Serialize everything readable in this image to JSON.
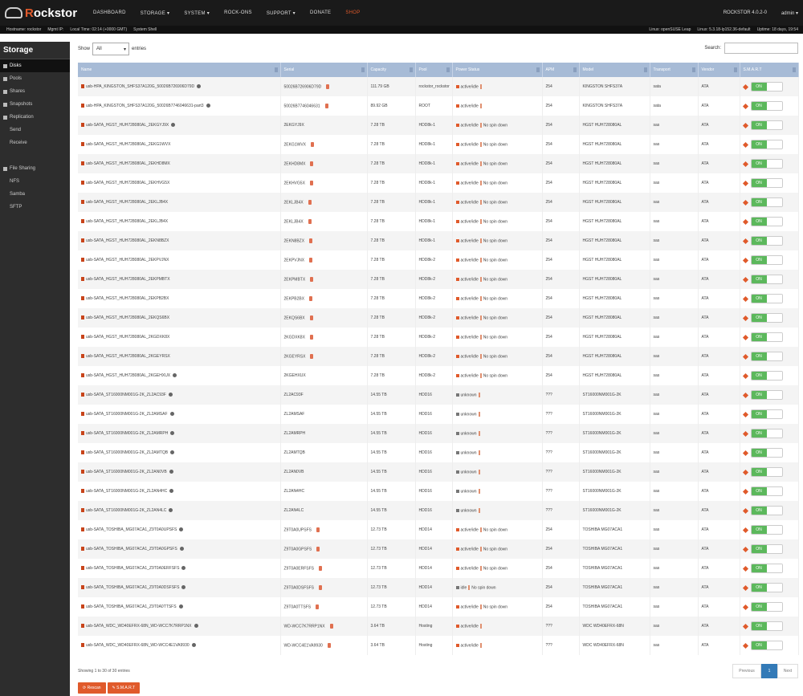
{
  "header": {
    "brand": "Rockstor",
    "nav": [
      "DASHBOARD",
      "STORAGE ▾",
      "SYSTEM ▾",
      "ROCK-ONS",
      "SUPPORT ▾",
      "DONATE",
      "SHOP"
    ],
    "version": "ROCKSTOR 4.0.2-0",
    "user": "admin ▾"
  },
  "statusbar": {
    "hostname": "Hostname: rockstor",
    "mgmt_ip": "Mgmt IP:",
    "local_time": "Local Time: 02:14 (+0000 GMT)",
    "system_shell": "System Shell",
    "os": "Linux: openSUSE Leap",
    "kernel": "Linux: 5.3.18-lp152.36-default",
    "uptime": "Uptime: 18 days, 19:54"
  },
  "sidebar": {
    "title": "Storage",
    "items": [
      {
        "label": "Disks",
        "active": true,
        "sub": false
      },
      {
        "label": "Pools",
        "active": false,
        "sub": false
      },
      {
        "label": "Shares",
        "active": false,
        "sub": false
      },
      {
        "label": "Snapshots",
        "active": false,
        "sub": false
      },
      {
        "label": "Replication",
        "active": false,
        "sub": false
      },
      {
        "label": "Send",
        "active": false,
        "sub": true
      },
      {
        "label": "Receive",
        "active": false,
        "sub": true
      },
      {
        "label": "",
        "active": false,
        "sub": false
      },
      {
        "label": "File Sharing",
        "active": false,
        "sub": false
      },
      {
        "label": "NFS",
        "active": false,
        "sub": true
      },
      {
        "label": "Samba",
        "active": false,
        "sub": true
      },
      {
        "label": "SFTP",
        "active": false,
        "sub": true
      }
    ]
  },
  "controls": {
    "show_label": "Show",
    "show_value": "All",
    "entries_label": "entries",
    "search_label": "Search:",
    "search_placeholder": ""
  },
  "table": {
    "columns": [
      "Name",
      "Serial",
      "Capacity",
      "Pool",
      "Power Status",
      "APM",
      "Model",
      "Transport",
      "Vendor",
      "S.M.A.R.T"
    ],
    "rows": [
      {
        "name": "usb-HPA_KINGSTON_SHFS37A120G_50026B726906D79D",
        "serial": "50026B726906D79D",
        "cap": "111.79 GB",
        "pool": "rockstor_rockstor",
        "power": "active/idle",
        "apm": "254",
        "model": "KINGSTON SHFS37A",
        "transport": "sata",
        "vendor": "ATA",
        "info": true,
        "cog": true,
        "pgrey": false,
        "spin": false
      },
      {
        "name": "usb-HPA_KINGSTON_SHFS37A120G_50026B7746046631-part3",
        "serial": "50026B7746046631",
        "cap": "89.92 GB",
        "pool": "ROOT",
        "power": "active/idle",
        "apm": "254",
        "model": "KINGSTON SHFS37A",
        "transport": "sata",
        "vendor": "ATA",
        "info": true,
        "cog": true,
        "pgrey": false,
        "spin": false
      },
      {
        "name": "usb-SATA_HGST_HUH728080AL_2EKGYJ9X",
        "serial": "2EKGYJ9X",
        "cap": "7.28 TB",
        "pool": "HDD8k-1",
        "power": "active/idle",
        "apm": "254",
        "model": "HGST HUH728080AL",
        "transport": "sas",
        "vendor": "ATA",
        "info": true,
        "cog": false,
        "pgrey": false,
        "spin": true
      },
      {
        "name": "usb-SATA_HGST_HUH728080AL_2EKG1WVX",
        "serial": "2EKG1WVX",
        "cap": "7.28 TB",
        "pool": "HDD8k-1",
        "power": "active/idle",
        "apm": "254",
        "model": "HGST HUH728080AL",
        "transport": "sas",
        "vendor": "ATA",
        "info": false,
        "cog": true,
        "pgrey": false,
        "spin": true
      },
      {
        "name": "usb-SATA_HGST_HUH728080AL_2EKHD8MX",
        "serial": "2EKHD8MX",
        "cap": "7.28 TB",
        "pool": "HDD8k-1",
        "power": "active/idle",
        "apm": "254",
        "model": "HGST HUH728080AL",
        "transport": "sas",
        "vendor": "ATA",
        "info": false,
        "cog": true,
        "pgrey": false,
        "spin": true
      },
      {
        "name": "usb-SATA_HGST_HUH728080AL_2EKHVG5X",
        "serial": "2EKHVG5X",
        "cap": "7.28 TB",
        "pool": "HDD8k-1",
        "power": "active/idle",
        "apm": "254",
        "model": "HGST HUH728080AL",
        "transport": "sas",
        "vendor": "ATA",
        "info": false,
        "cog": true,
        "pgrey": false,
        "spin": true
      },
      {
        "name": "usb-SATA_HGST_HUH728080AL_2EKLJB4X",
        "serial": "2EKLJB4X",
        "cap": "7.28 TB",
        "pool": "HDD8k-1",
        "power": "active/idle",
        "apm": "254",
        "model": "HGST HUH728080AL",
        "transport": "sas",
        "vendor": "ATA",
        "info": false,
        "cog": true,
        "pgrey": false,
        "spin": true
      },
      {
        "name": "usb-SATA_HGST_HUH728080AL_2EKLJB4X",
        "serial": "2EKLJB4X",
        "cap": "7.28 TB",
        "pool": "HDD8k-1",
        "power": "active/idle",
        "apm": "254",
        "model": "HGST HUH728080AL",
        "transport": "sas",
        "vendor": "ATA",
        "info": false,
        "cog": true,
        "pgrey": false,
        "spin": true
      },
      {
        "name": "usb-SATA_HGST_HUH728080AL_2EKN8BZX",
        "serial": "2EKN8BZX",
        "cap": "7.28 TB",
        "pool": "HDD8k-1",
        "power": "active/idle",
        "apm": "254",
        "model": "HGST HUH728080AL",
        "transport": "sas",
        "vendor": "ATA",
        "info": false,
        "cog": true,
        "pgrey": false,
        "spin": true
      },
      {
        "name": "usb-SATA_HGST_HUH728080AL_2EKPVJNX",
        "serial": "2EKPVJNX",
        "cap": "7.28 TB",
        "pool": "HDD8k-2",
        "power": "active/idle",
        "apm": "254",
        "model": "HGST HUH728080AL",
        "transport": "sas",
        "vendor": "ATA",
        "info": false,
        "cog": true,
        "pgrey": false,
        "spin": true
      },
      {
        "name": "usb-SATA_HGST_HUH728080AL_2EKPMBTX",
        "serial": "2EKPMBTX",
        "cap": "7.28 TB",
        "pool": "HDD8k-2",
        "power": "active/idle",
        "apm": "254",
        "model": "HGST HUH728080AL",
        "transport": "sas",
        "vendor": "ATA",
        "info": false,
        "cog": true,
        "pgrey": false,
        "spin": true
      },
      {
        "name": "usb-SATA_HGST_HUH728080AL_2EKPB2BX",
        "serial": "2EKPB2BX",
        "cap": "7.28 TB",
        "pool": "HDD8k-2",
        "power": "active/idle",
        "apm": "254",
        "model": "HGST HUH728080AL",
        "transport": "sas",
        "vendor": "ATA",
        "info": false,
        "cog": true,
        "pgrey": false,
        "spin": true
      },
      {
        "name": "usb-SATA_HGST_HUH728080AL_2EKQS6BX",
        "serial": "2EKQS6BX",
        "cap": "7.28 TB",
        "pool": "HDD8k-2",
        "power": "active/idle",
        "apm": "254",
        "model": "HGST HUH728080AL",
        "transport": "sas",
        "vendor": "ATA",
        "info": false,
        "cog": true,
        "pgrey": false,
        "spin": true
      },
      {
        "name": "usb-SATA_HGST_HUH728080AL_2KGDXK8X",
        "serial": "2KGDXK8X",
        "cap": "7.28 TB",
        "pool": "HDD8k-2",
        "power": "active/idle",
        "apm": "254",
        "model": "HGST HUH728080AL",
        "transport": "sas",
        "vendor": "ATA",
        "info": false,
        "cog": true,
        "pgrey": false,
        "spin": true
      },
      {
        "name": "usb-SATA_HGST_HUH728080AL_2KGEYRSX",
        "serial": "2KGEYRSX",
        "cap": "7.28 TB",
        "pool": "HDD8k-2",
        "power": "active/idle",
        "apm": "254",
        "model": "HGST HUH728080AL",
        "transport": "sas",
        "vendor": "ATA",
        "info": false,
        "cog": true,
        "pgrey": false,
        "spin": true
      },
      {
        "name": "usb-SATA_HGST_HUH728080AL_2KGEHXUX",
        "serial": "2KGEHXUX",
        "cap": "7.28 TB",
        "pool": "HDD8k-2",
        "power": "active/idle",
        "apm": "254",
        "model": "HGST HUH728080AL",
        "transport": "sas",
        "vendor": "ATA",
        "info": true,
        "cog": false,
        "pgrey": false,
        "spin": true
      },
      {
        "name": "usb-SATA_ST16000NM001G-2K_ZL2AC93F",
        "serial": "ZL2AC93F",
        "cap": "14.55 TB",
        "pool": "HDD16",
        "power": "unknown",
        "apm": "???",
        "model": "ST16000NM001G-2K",
        "transport": "sas",
        "vendor": "ATA",
        "info": true,
        "cog": false,
        "pgrey": true,
        "spin": false
      },
      {
        "name": "usb-SATA_ST16000NM001G-2K_ZL2AMSAF",
        "serial": "ZL2AMSAF",
        "cap": "14.55 TB",
        "pool": "HDD16",
        "power": "unknown",
        "apm": "???",
        "model": "ST16000NM001G-2K",
        "transport": "sas",
        "vendor": "ATA",
        "info": true,
        "cog": false,
        "pgrey": true,
        "spin": false
      },
      {
        "name": "usb-SATA_ST16000NM001G-2K_ZL2AMRPH",
        "serial": "ZL2AMRPH",
        "cap": "14.55 TB",
        "pool": "HDD16",
        "power": "unknown",
        "apm": "???",
        "model": "ST16000NM001G-2K",
        "transport": "sas",
        "vendor": "ATA",
        "info": true,
        "cog": false,
        "pgrey": true,
        "spin": false
      },
      {
        "name": "usb-SATA_ST16000NM001G-2K_ZL2AMTQB",
        "serial": "ZL2AMTQB",
        "cap": "14.55 TB",
        "pool": "HDD16",
        "power": "unknown",
        "apm": "???",
        "model": "ST16000NM001G-2K",
        "transport": "sas",
        "vendor": "ATA",
        "info": true,
        "cog": false,
        "pgrey": true,
        "spin": false
      },
      {
        "name": "usb-SATA_ST16000NM001G-2K_ZL2AN0VB",
        "serial": "ZL2AN0VB",
        "cap": "14.55 TB",
        "pool": "HDD16",
        "power": "unknown",
        "apm": "???",
        "model": "ST16000NM001G-2K",
        "transport": "sas",
        "vendor": "ATA",
        "info": true,
        "cog": false,
        "pgrey": true,
        "spin": false
      },
      {
        "name": "usb-SATA_ST16000NM001G-2K_ZL2AN4HC",
        "serial": "ZL2AN4HC",
        "cap": "14.55 TB",
        "pool": "HDD16",
        "power": "unknown",
        "apm": "???",
        "model": "ST16000NM001G-2K",
        "transport": "sas",
        "vendor": "ATA",
        "info": true,
        "cog": false,
        "pgrey": true,
        "spin": false
      },
      {
        "name": "usb-SATA_ST16000NM001G-2K_ZL2AN4LC",
        "serial": "ZL2AN4LC",
        "cap": "14.55 TB",
        "pool": "HDD16",
        "power": "unknown",
        "apm": "???",
        "model": "ST16000NM001G-2K",
        "transport": "sas",
        "vendor": "ATA",
        "info": true,
        "cog": false,
        "pgrey": true,
        "spin": false
      },
      {
        "name": "usb-SATA_TOSHIBA_MG07ACA1_Z9T0A0UPSFS",
        "serial": "Z9T0A0UPSFS",
        "cap": "12.73 TB",
        "pool": "HDD14",
        "power": "active/idle",
        "apm": "254",
        "model": "TOSHIBA MG07ACA1",
        "transport": "sas",
        "vendor": "ATA",
        "info": true,
        "cog": true,
        "pgrey": false,
        "spin": true
      },
      {
        "name": "usb-SATA_TOSHIBA_MG07ACA1_Z9T0A0GPSFS",
        "serial": "Z9T0A0GPSFS",
        "cap": "12.73 TB",
        "pool": "HDD14",
        "power": "active/idle",
        "apm": "254",
        "model": "TOSHIBA MG07ACA1",
        "transport": "sas",
        "vendor": "ATA",
        "info": true,
        "cog": true,
        "pgrey": false,
        "spin": true
      },
      {
        "name": "usb-SATA_TOSHIBA_MG07ACA1_Z9T0A0ERFSFS",
        "serial": "Z9T0A0ERFSFS",
        "cap": "12.73 TB",
        "pool": "HDD14",
        "power": "active/idle",
        "apm": "254",
        "model": "TOSHIBA MG07ACA1",
        "transport": "sas",
        "vendor": "ATA",
        "info": true,
        "cog": true,
        "pgrey": false,
        "spin": true
      },
      {
        "name": "usb-SATA_TOSHIBA_MG07ACA1_Z9T0A0DSFSFS",
        "serial": "Z9T0A0DSFSFS",
        "cap": "12.73 TB",
        "pool": "HDD14",
        "power": "idle",
        "apm": "254",
        "model": "TOSHIBA MG07ACA1",
        "transport": "sas",
        "vendor": "ATA",
        "info": true,
        "cog": true,
        "pgrey": true,
        "spin": true
      },
      {
        "name": "usb-SATA_TOSHIBA_MG07ACA1_Z9T0A0TTSFS",
        "serial": "Z9T0A0TTSFS",
        "cap": "12.73 TB",
        "pool": "HDD14",
        "power": "active/idle",
        "apm": "254",
        "model": "TOSHIBA MG07ACA1",
        "transport": "sas",
        "vendor": "ATA",
        "info": true,
        "cog": true,
        "pgrey": false,
        "spin": true
      },
      {
        "name": "usb-SATA_WDC_WD40EFRX-68N_WD-WCC7K7RRP1NX",
        "serial": "WD-WCC7K7RRP1NX",
        "cap": "3.64 TB",
        "pool": "Hosting",
        "power": "active/idle",
        "apm": "???",
        "model": "WDC WD40EFRX-68N",
        "transport": "sas",
        "vendor": "ATA",
        "info": true,
        "cog": true,
        "pgrey": false,
        "spin": false
      },
      {
        "name": "usb-SATA_WDC_WD40EFRX-68N_WD-WCC4E1VA9930",
        "serial": "WD-WCC4E1VA9930",
        "cap": "3.64 TB",
        "pool": "Hosting",
        "power": "active/idle",
        "apm": "???",
        "model": "WDC WD40EFRX-68N",
        "transport": "sas",
        "vendor": "ATA",
        "info": true,
        "cog": true,
        "pgrey": false,
        "spin": false
      }
    ],
    "no_spin_text": "No spin down",
    "smart_on": "ON"
  },
  "footer": {
    "info": "Showing 1 to 30 of 30 entries",
    "prev": "Previous",
    "page": "1",
    "next": "Next",
    "rescan": "Rescan",
    "smart_button": "S.M.A.R.T"
  }
}
